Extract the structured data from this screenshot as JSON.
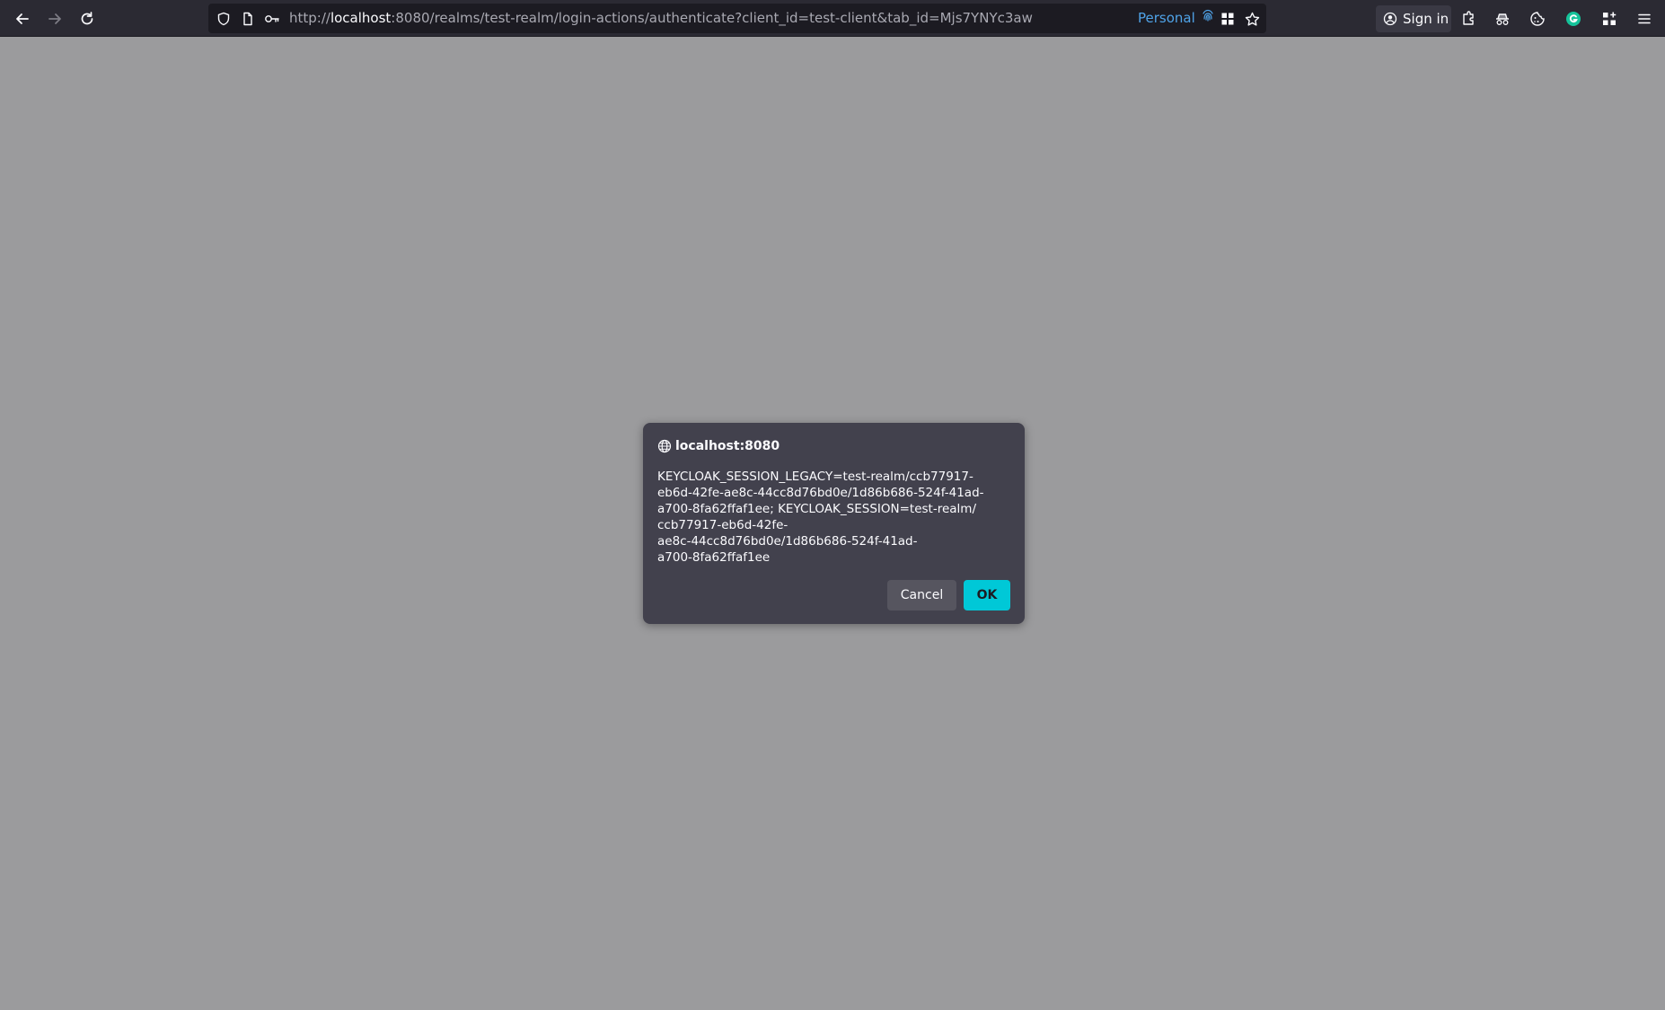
{
  "browser": {
    "url_scheme": "http://",
    "url_host": "localhost",
    "url_rest": ":8080/realms/test-realm/login-actions/authenticate?client_id=test-client&tab_id=Mjs7YNYc3aw",
    "container_label": "Personal",
    "signin_label": "Sign in"
  },
  "dialog": {
    "origin": "localhost:8080",
    "message": "KEYCLOAK_SESSION_LEGACY=test-realm/ccb77917-\neb6d-42fe-ae8c-44cc8d76bd0e/1d86b686-524f-41ad-\na700-8fa62ffaf1ee; KEYCLOAK_SESSION=test-realm/\nccb77917-eb6d-42fe-\nae8c-44cc8d76bd0e/1d86b686-524f-41ad-\na700-8fa62ffaf1ee",
    "cancel_label": "Cancel",
    "ok_label": "OK"
  },
  "colors": {
    "accent": "#00c8d7",
    "container": "#4fa3e8",
    "backdrop": "#9b9b9d"
  },
  "icons": {
    "back": "back-arrow-icon",
    "forward": "forward-arrow-icon",
    "reload": "reload-icon",
    "shield": "shield-icon",
    "page": "page-icon",
    "key": "key-icon",
    "fingerprint": "fingerprint-icon",
    "grid": "grid-icon",
    "star": "star-icon",
    "account": "account-icon",
    "extension": "extension-icon",
    "incognito": "incognito-icon",
    "cookie": "cookie-icon",
    "grammarly": "grammarly-icon",
    "apps": "apps-icon",
    "menu": "menu-icon",
    "globe": "globe-icon"
  }
}
